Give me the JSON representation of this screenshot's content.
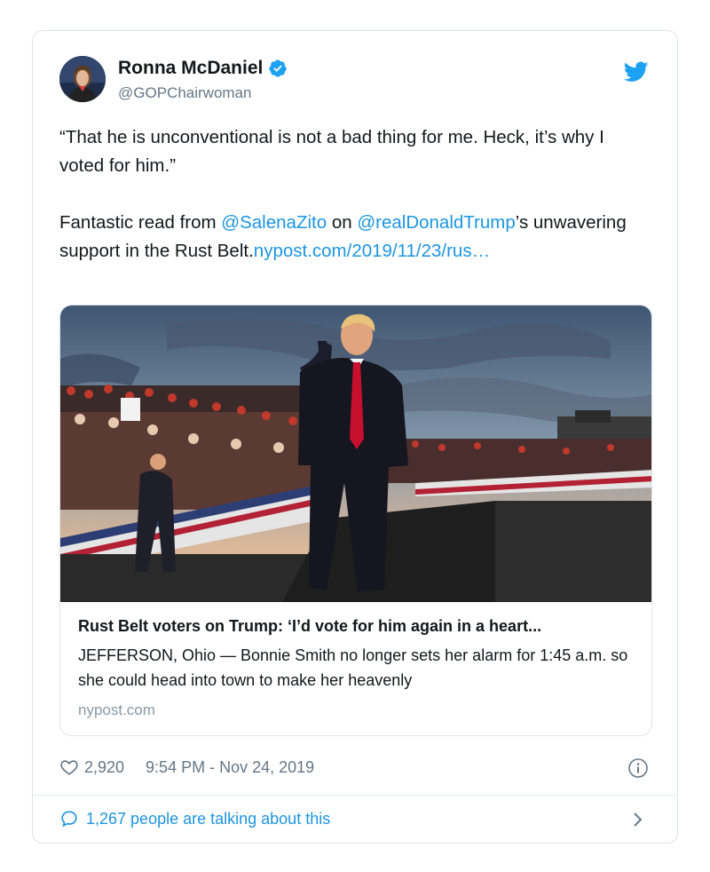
{
  "author": {
    "name": "Ronna McDaniel",
    "handle": "@GOPChairwoman",
    "verified": true
  },
  "tweet": {
    "quote_line": "“That he is unconventional is not a bad thing for me. Heck, it’s why I voted for him.”",
    "body_prefix": "Fantastic read from ",
    "mention_1": "@SalenaZito",
    "body_middle": " on ",
    "mention_2": "@realDonaldTrump",
    "body_suffix": "’s unwavering support in the Rust Belt.",
    "link": "nypost.com/2019/11/23/rus…"
  },
  "card": {
    "image_alt": "Rally photo",
    "title": "Rust Belt voters on Trump: ‘I’d vote for him again in a heart...",
    "description": "JEFFERSON, Ohio — Bonnie Smith no longer sets her alarm for 1:45 a.m. so she could head into town to make her heavenly",
    "domain": "nypost.com"
  },
  "meta": {
    "likes": "2,920",
    "timestamp": "9:54 PM - Nov 24, 2019"
  },
  "footer": {
    "talking": "1,267 people are talking about this"
  },
  "colors": {
    "link": "#1b95e0",
    "secondary_text": "#657786",
    "verified": "#1da1f2"
  },
  "icons": [
    "twitter-bird-icon",
    "verified-badge-icon",
    "heart-icon",
    "info-icon",
    "speech-bubble-icon",
    "chevron-right-icon"
  ]
}
